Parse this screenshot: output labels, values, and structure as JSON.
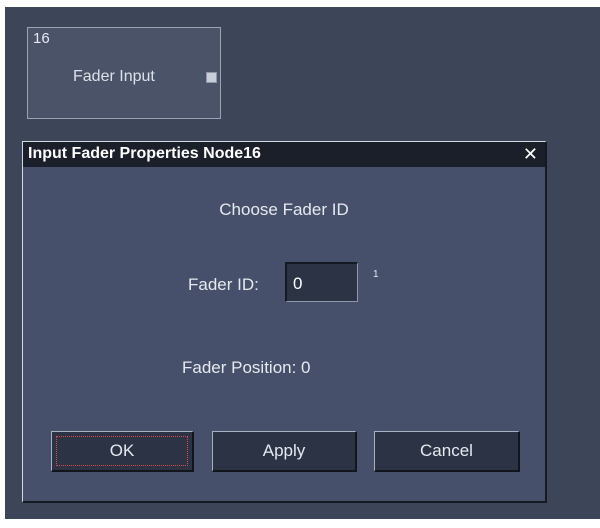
{
  "node": {
    "id": "16",
    "label": "Fader Input"
  },
  "dialog": {
    "title": "Input Fader Properties Node16",
    "close_glyph": "✕",
    "heading": "Choose Fader ID",
    "fader_id_label": "Fader ID:",
    "fader_id_value": "0",
    "fader_id_superscript": "1",
    "fader_position_text": "Fader Position:  0",
    "buttons": {
      "ok": "OK",
      "apply": "Apply",
      "cancel": "Cancel"
    }
  },
  "icons": {
    "close": "close-icon",
    "output_port": "output-port-icon"
  },
  "colors": {
    "canvas": "#3d4558",
    "dialog": "#46506a",
    "title_bar": "#1b1f29",
    "button": "#2c3344",
    "focus_ring": "#d94a4a"
  }
}
